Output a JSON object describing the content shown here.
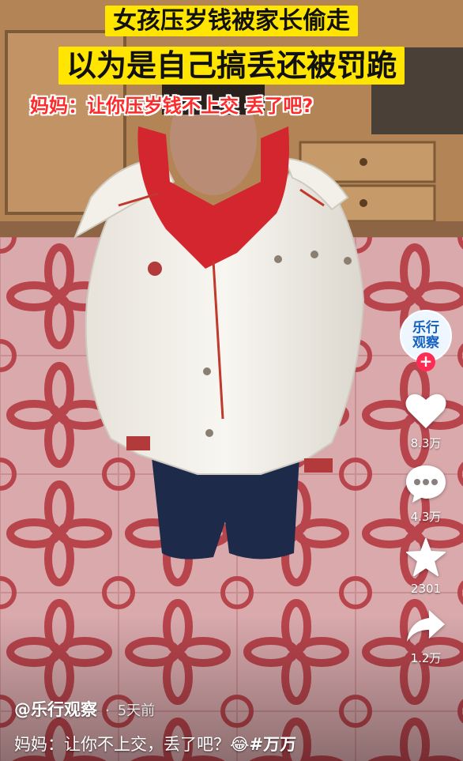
{
  "video_overlay": {
    "title_line_1": "女孩压岁钱被家长偷走",
    "title_line_2": "以为是自己搞丢还被罚跪",
    "title_line_3": "妈妈：让你压岁钱不上交 丢了吧?"
  },
  "creator": {
    "avatar_text": "乐行观察",
    "follow_label": "+"
  },
  "actions": {
    "like_count": "8.3万",
    "comment_count": "4.3万",
    "favorite_count": "2301",
    "share_count": "1.2万"
  },
  "post": {
    "author": "@乐行观察",
    "separator": "·",
    "time": "5天前",
    "caption_text": "妈妈：让你不上交，丢了吧？",
    "emoji": "😂",
    "hashtag": "#万万"
  },
  "icons": {
    "like": "heart-icon",
    "comment": "comment-bubble-icon",
    "favorite": "star-icon",
    "share": "share-arrow-icon"
  },
  "colors": {
    "title_bg": "#ffe500",
    "subtitle_text": "#ff2a2a",
    "follow": "#fe2c55",
    "avatar_text": "#1560c0"
  }
}
